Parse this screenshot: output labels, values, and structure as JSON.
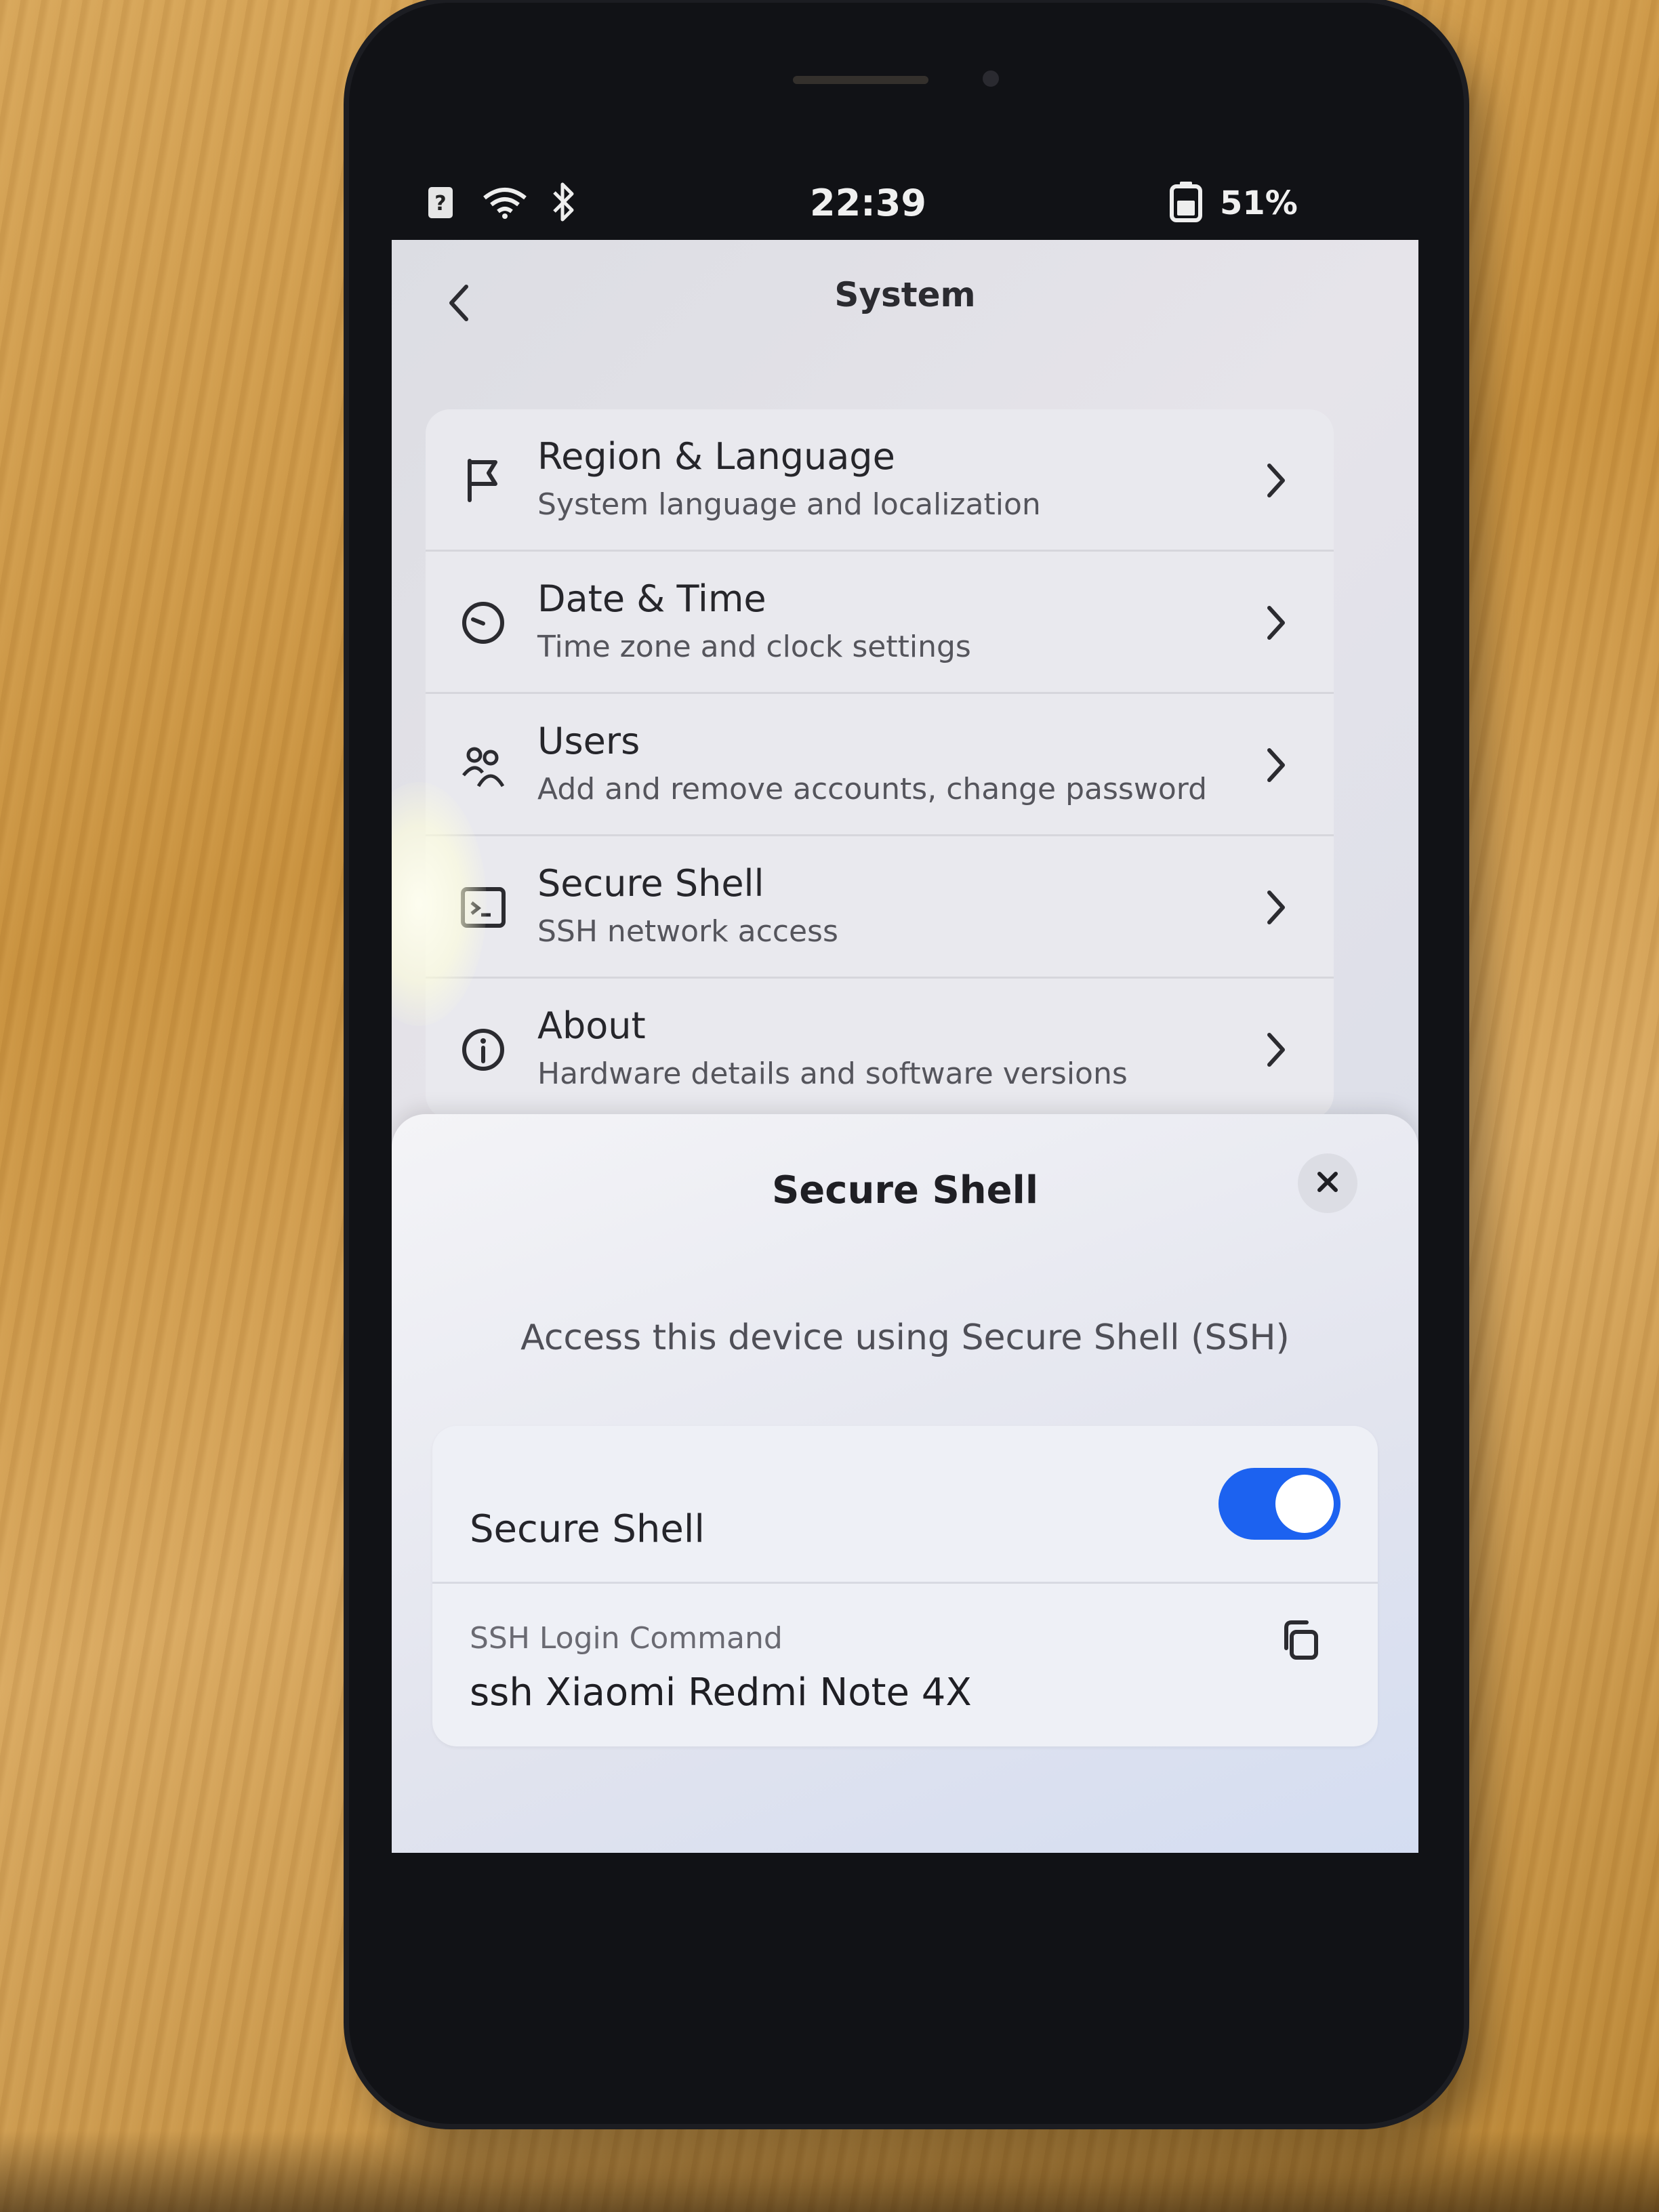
{
  "status_bar": {
    "time": "22:39",
    "battery": "51%",
    "icons": [
      "unknown-sim-icon",
      "wifi-icon",
      "bluetooth-icon",
      "battery-icon"
    ]
  },
  "header": {
    "title": "System",
    "back_icon": "chevron-left-icon"
  },
  "settings_list": {
    "items": [
      {
        "title": "Region & Language",
        "subtitle": "System language and localization",
        "icon": "flag-icon"
      },
      {
        "title": "Date & Time",
        "subtitle": "Time zone and clock settings",
        "icon": "clock-icon"
      },
      {
        "title": "Users",
        "subtitle": "Add and remove accounts, change password",
        "icon": "users-icon"
      },
      {
        "title": "Secure Shell",
        "subtitle": "SSH network access",
        "icon": "terminal-icon"
      },
      {
        "title": "About",
        "subtitle": "Hardware details and software versions",
        "icon": "info-icon"
      }
    ]
  },
  "dialog": {
    "title": "Secure Shell",
    "description": "Access this device using Secure Shell (SSH)",
    "toggle": {
      "label": "Secure Shell",
      "enabled": true
    },
    "login_command": {
      "label": "SSH Login Command",
      "value": "ssh Xiaomi Redmi Note 4X"
    }
  },
  "colors": {
    "accent": "#1c62f0",
    "text_primary": "#26262b",
    "text_secondary": "#55555c"
  }
}
